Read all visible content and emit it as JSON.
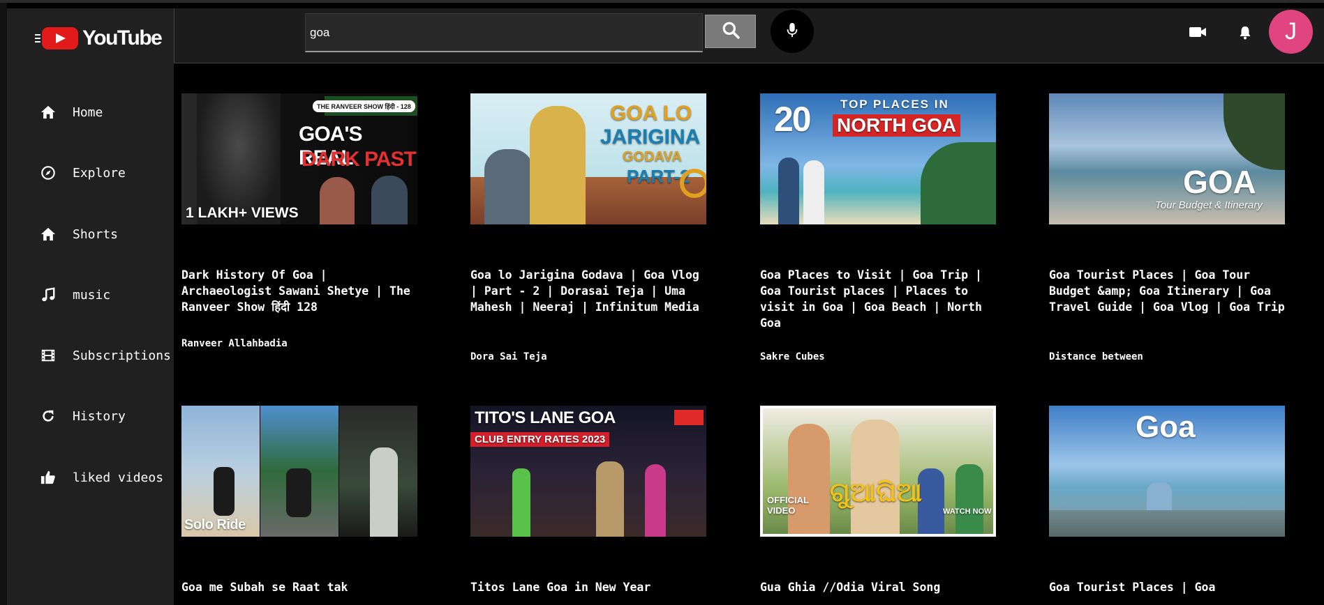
{
  "app": {
    "brand": "YouTube"
  },
  "search": {
    "query": "goa"
  },
  "header": {
    "avatar_initial": "J"
  },
  "sidebar": {
    "items": [
      {
        "label": "Home",
        "icon": "home-icon"
      },
      {
        "label": "Explore",
        "icon": "compass-icon"
      },
      {
        "label": "Shorts",
        "icon": "home-icon"
      },
      {
        "label": "music",
        "icon": "music-note-icon"
      },
      {
        "label": "Subscriptions",
        "icon": "film-icon"
      },
      {
        "label": "History",
        "icon": "history-icon"
      },
      {
        "label": "liked videos",
        "icon": "thumbs-up-icon"
      }
    ]
  },
  "videos": [
    {
      "title": "Dark History Of Goa | Archaeologist Sawani Shetye | The Ranveer Show हिंदी 128",
      "channel": "Ranveer Allahbadia",
      "thumb_text": [
        "THE RANVEER SHOW हिंदी - 128",
        "GOA'S REAL",
        "DARK PAST",
        "1 LAKH+ VIEWS"
      ]
    },
    {
      "title": "Goa lo Jarigina Godava | Goa Vlog | Part - 2 | Dorasai Teja | Uma Mahesh | Neeraj | Infinitum Media",
      "channel": "Dora Sai Teja",
      "thumb_text": [
        "GOA LO",
        "JARIGINA",
        "GODAVA",
        "PART-2"
      ]
    },
    {
      "title": "Goa Places to Visit | Goa Trip | Goa Tourist places | Places to visit in Goa | Goa Beach | North Goa",
      "channel": "Sakre Cubes",
      "thumb_text": [
        "20",
        "TOP PLACES IN",
        "NORTH GOA"
      ]
    },
    {
      "title": "Goa Tourist Places | Goa Tour Budget &amp; Goa Itinerary | Goa Travel Guide | Goa Vlog | Goa Trip",
      "channel": "Distance between",
      "thumb_text": [
        "GOA",
        "Tour Budget & Itinerary"
      ]
    },
    {
      "title": "Goa me Subah se Raat tak",
      "channel": "",
      "thumb_text": [
        "Solo Ride"
      ]
    },
    {
      "title": "Titos Lane Goa in New Year",
      "channel": "",
      "thumb_text": [
        "TITO'S LANE GOA",
        "CLUB ENTRY RATES 2023"
      ]
    },
    {
      "title": "Gua Ghia //Odia Viral Song",
      "channel": "",
      "thumb_text": [
        "OFFICIAL VIDEO",
        "ଗୁଆଘିଆ",
        "WATCH NOW"
      ]
    },
    {
      "title": "Goa Tourist Places | Goa",
      "channel": "",
      "thumb_text": [
        "Goa"
      ]
    }
  ]
}
